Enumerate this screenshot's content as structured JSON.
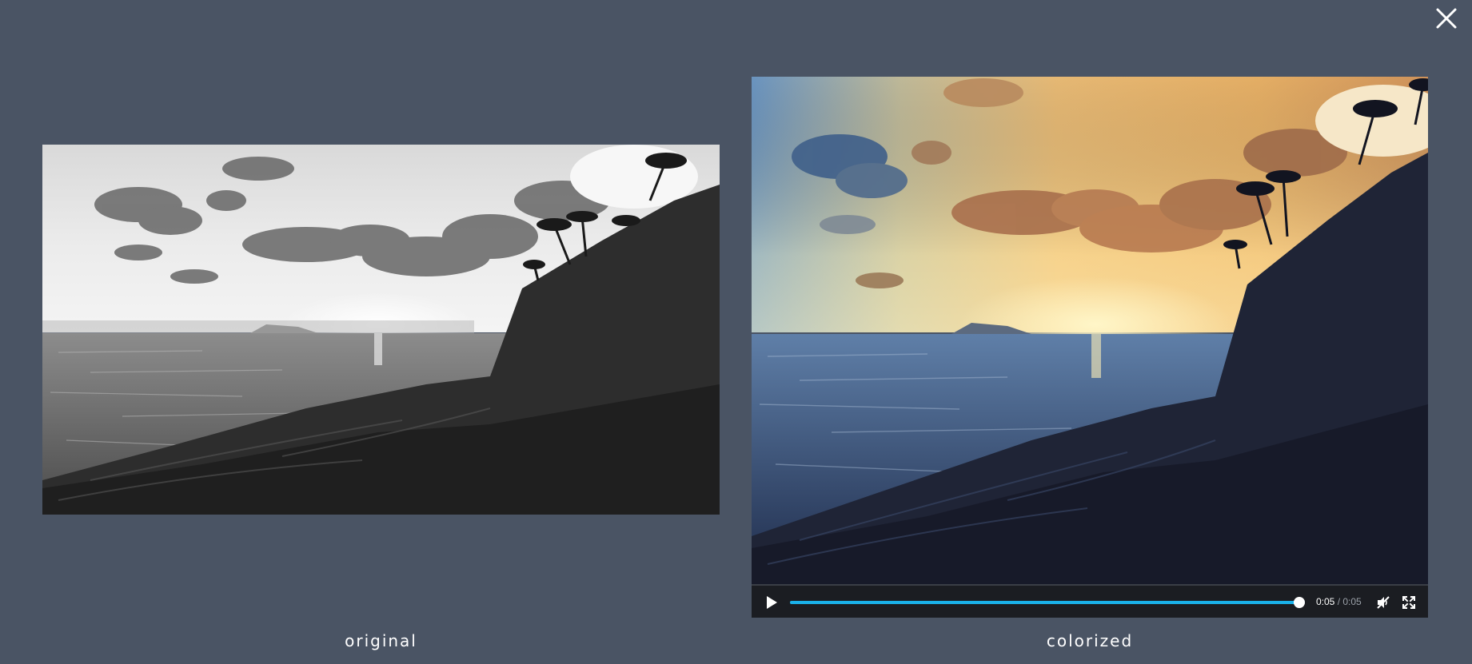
{
  "viewer": {
    "close_icon": "close-icon"
  },
  "original": {
    "caption": "original"
  },
  "colorized": {
    "caption": "colorized",
    "player": {
      "play_icon": "play-icon",
      "current_time": "0:05",
      "separator": " / ",
      "duration": "0:05",
      "progress": 1.0,
      "mute_icon": "volume-muted-icon",
      "fullscreen_icon": "fullscreen-icon",
      "accent_color": "#1ab1ea"
    }
  }
}
